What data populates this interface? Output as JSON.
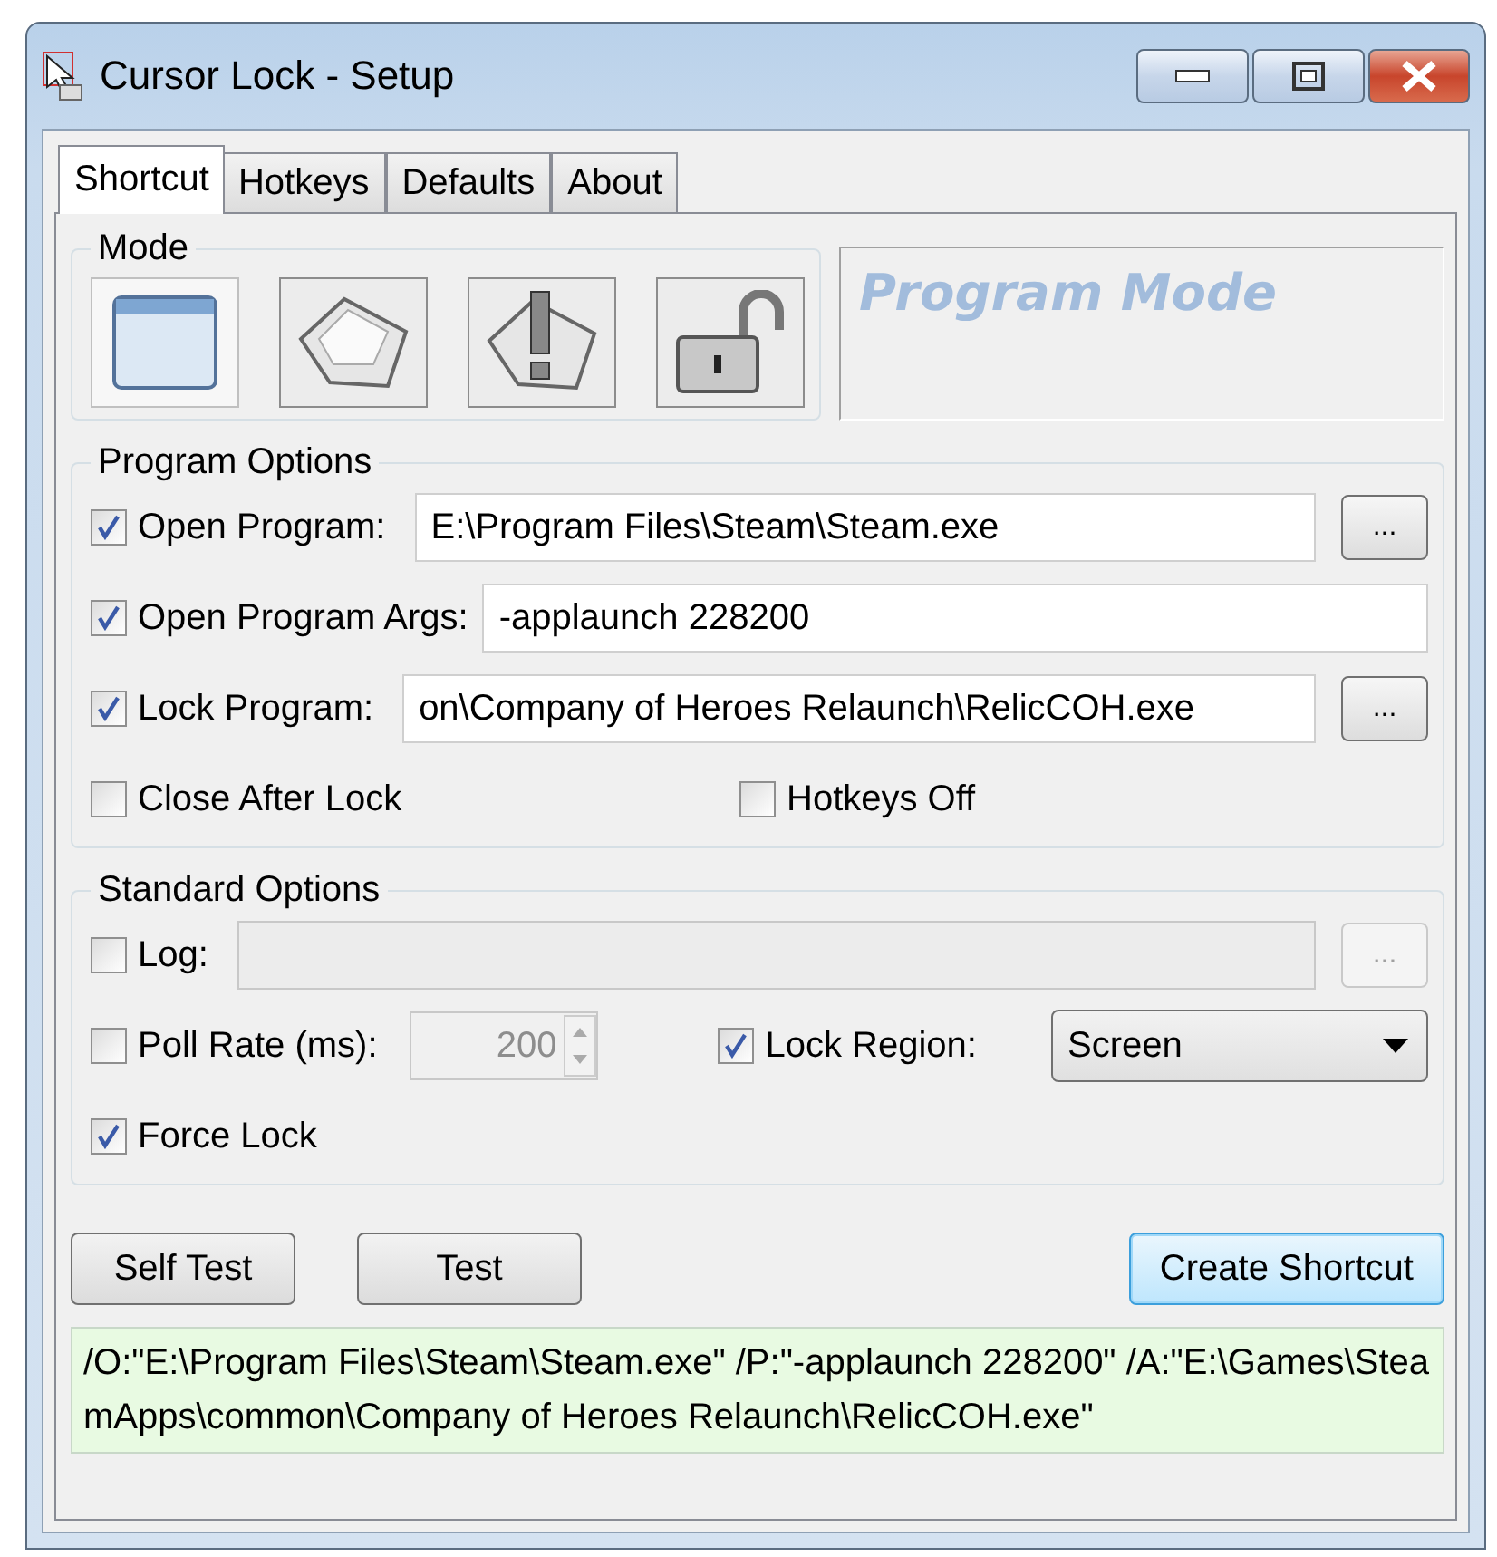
{
  "window": {
    "title": "Cursor Lock - Setup"
  },
  "tabs": [
    {
      "label": "Shortcut",
      "selected": true
    },
    {
      "label": "Hotkeys",
      "selected": false
    },
    {
      "label": "Defaults",
      "selected": false
    },
    {
      "label": "About",
      "selected": false
    }
  ],
  "mode": {
    "label": "Mode",
    "caption": "Program Mode",
    "buttons": [
      {
        "kind": "window",
        "selected": true
      },
      {
        "kind": "key",
        "selected": false
      },
      {
        "kind": "alert-key",
        "selected": false
      },
      {
        "kind": "unlock",
        "selected": false
      }
    ]
  },
  "program_options": {
    "label": "Program Options",
    "rows": [
      {
        "label": "Open Program:",
        "checked": true,
        "value": "E:\\Program Files\\Steam\\Steam.exe",
        "browse": "..."
      },
      {
        "label": "Open Program Args:",
        "checked": true,
        "value": "-applaunch 228200"
      },
      {
        "label": "Lock Program:",
        "checked": true,
        "value": "on\\Company of Heroes Relaunch\\RelicCOH.exe",
        "browse": "..."
      }
    ],
    "flags": [
      {
        "label": "Close After Lock",
        "checked": false
      },
      {
        "label": "Hotkeys Off",
        "checked": false
      }
    ]
  },
  "standard_options": {
    "label": "Standard Options",
    "log": {
      "label": "Log:",
      "checked": false,
      "disabled": true,
      "browse": "..."
    },
    "poll_rate": {
      "label": "Poll Rate (ms):",
      "checked": false,
      "value": "200",
      "disabled": true
    },
    "lock_region": {
      "label": "Lock Region:",
      "checked": true,
      "value": "Screen"
    },
    "force_lock": {
      "label": "Force Lock",
      "checked": true
    }
  },
  "buttons": [
    {
      "label": "Self Test",
      "default": false
    },
    {
      "label": "Test",
      "default": false
    },
    {
      "label": "Create Shortcut",
      "default": true
    }
  ],
  "output": "/O:\"E:\\Program Files\\Steam\\Steam.exe\" /P:\"-applaunch 228200\" /A:\"E:\\Games\\SteamApps\\common\\Company of Heroes Relaunch\\RelicCOH.exe\""
}
